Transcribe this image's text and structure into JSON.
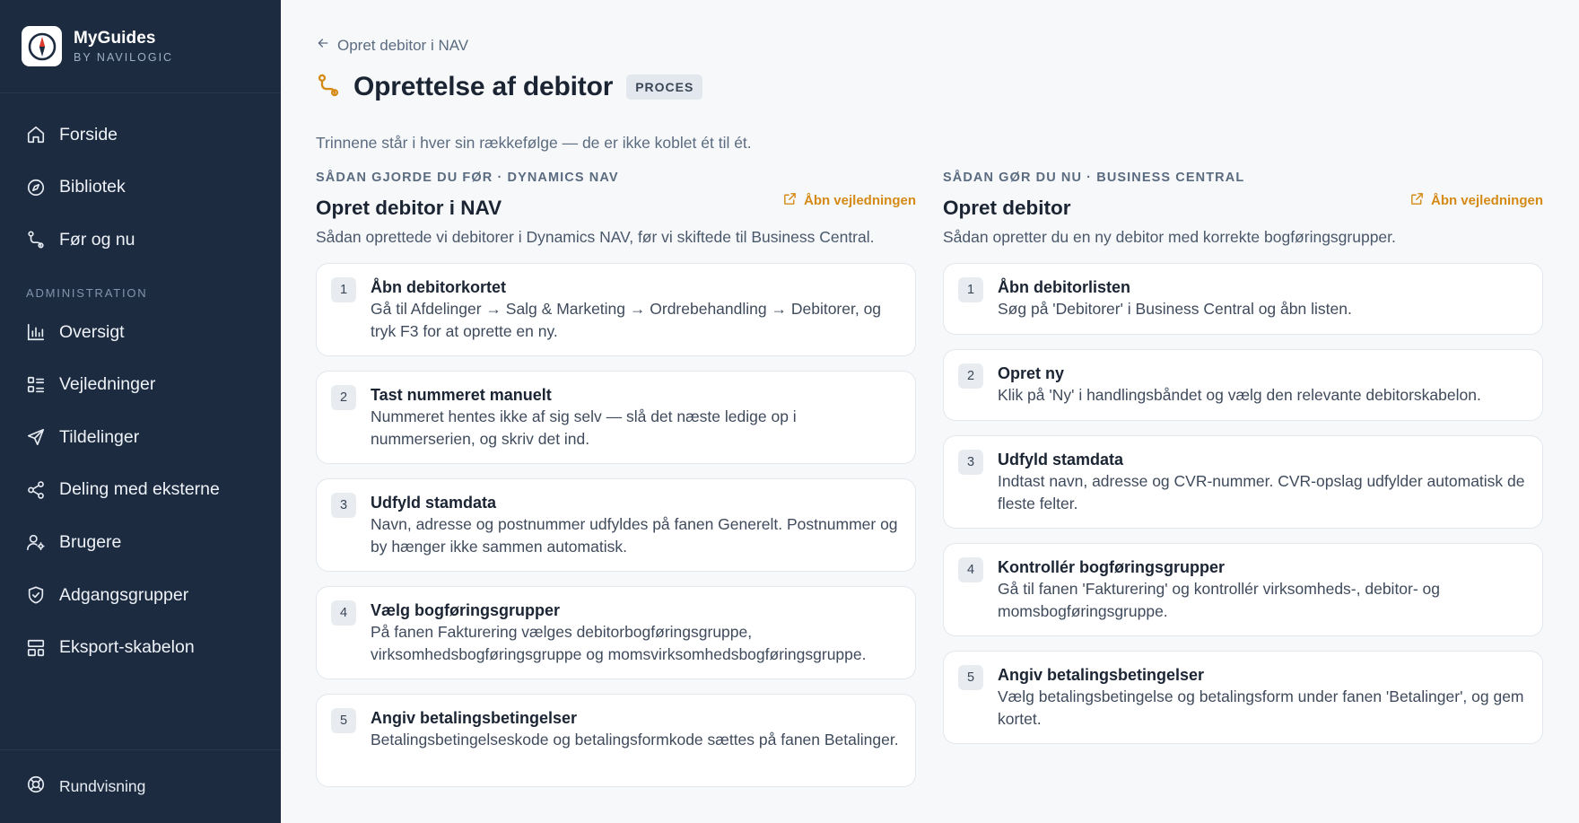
{
  "brand": {
    "name": "MyGuides",
    "sub": "BY NAVILOGIC"
  },
  "sidebar": {
    "items": [
      {
        "label": "Forside",
        "icon": "home-icon"
      },
      {
        "label": "Bibliotek",
        "icon": "compass-icon"
      },
      {
        "label": "Før og nu",
        "icon": "route-icon"
      }
    ],
    "section_label": "ADMINISTRATION",
    "admin_items": [
      {
        "label": "Oversigt",
        "icon": "bar-chart-icon"
      },
      {
        "label": "Vejledninger",
        "icon": "list-icon"
      },
      {
        "label": "Tildelinger",
        "icon": "send-icon"
      },
      {
        "label": "Deling med eksterne",
        "icon": "share-icon"
      },
      {
        "label": "Brugere",
        "icon": "user-icon"
      },
      {
        "label": "Adgangsgrupper",
        "icon": "shield-icon"
      },
      {
        "label": "Eksport-skabelon",
        "icon": "template-icon"
      }
    ],
    "footer_label": "Rundvisning"
  },
  "header": {
    "back_label": "Opret debitor i NAV",
    "title": "Oprettelse af debitor",
    "badge": "PROCES",
    "intro": "Trinnene står i hver sin rækkefølge — de er ikke koblet ét til ét."
  },
  "left": {
    "eyebrow": "SÅDAN GJORDE DU FØR · DYNAMICS NAV",
    "title": "Opret debitor i NAV",
    "open_label": "Åbn vejledningen",
    "desc": "Sådan oprettede vi debitorer i Dynamics NAV, før vi skiftede til Business Central.",
    "steps": [
      {
        "num": "1",
        "title": "Åbn debitorkortet",
        "text": "Gå til Afdelinger → Salg & Marketing → Ordrebehandling → Debitorer, og tryk F3 for at oprette en ny."
      },
      {
        "num": "2",
        "title": "Tast nummeret manuelt",
        "text": "Nummeret hentes ikke af sig selv — slå det næste ledige op i nummerserien, og skriv det ind."
      },
      {
        "num": "3",
        "title": "Udfyld stamdata",
        "text": "Navn, adresse og postnummer udfyldes på fanen Generelt. Postnummer og by hænger ikke sammen automatisk."
      },
      {
        "num": "4",
        "title": "Vælg bogføringsgrupper",
        "text": "På fanen Fakturering vælges debitorbogføringsgruppe, virksomhedsbogføringsgruppe og momsvirksomhedsbogføringsgruppe."
      },
      {
        "num": "5",
        "title": "Angiv betalingsbetingelser",
        "text": "Betalingsbetingelseskode og betalingsformkode sættes på fanen Betalinger."
      }
    ]
  },
  "right": {
    "eyebrow": "SÅDAN GØR DU NU · BUSINESS CENTRAL",
    "title": "Opret debitor",
    "open_label": "Åbn vejledningen",
    "desc": "Sådan opretter du en ny debitor med korrekte bogføringsgrupper.",
    "steps": [
      {
        "num": "1",
        "title": "Åbn debitorlisten",
        "text": "Søg på 'Debitorer' i Business Central og åbn listen."
      },
      {
        "num": "2",
        "title": "Opret ny",
        "text": "Klik på 'Ny' i handlingsbåndet og vælg den relevante debitorskabelon."
      },
      {
        "num": "3",
        "title": "Udfyld stamdata",
        "text": "Indtast navn, adresse og CVR-nummer. CVR-opslag udfylder automatisk de fleste felter."
      },
      {
        "num": "4",
        "title": "Kontrollér bogføringsgrupper",
        "text": "Gå til fanen 'Fakturering' og kontrollér virksomheds-, debitor- og momsbogføringsgruppe."
      },
      {
        "num": "5",
        "title": "Angiv betalingsbetingelser",
        "text": "Vælg betalingsbetingelse og betalingsform under fanen 'Betalinger', og gem kortet."
      }
    ]
  },
  "colors": {
    "sidebar": "#1c2b40",
    "accent": "#d48a15",
    "background": "#f7f8fa"
  }
}
